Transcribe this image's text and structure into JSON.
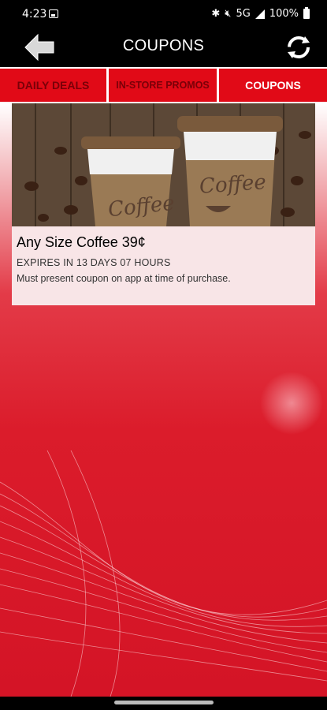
{
  "status_bar": {
    "time": "4:23",
    "network": "5G",
    "battery": "100%",
    "icons": [
      "image-icon",
      "bluetooth-icon",
      "mute-icon",
      "signal-icon",
      "battery-icon"
    ]
  },
  "header": {
    "title": "COUPONS",
    "back_icon": "back-arrow-icon",
    "refresh_icon": "refresh-icon"
  },
  "tabs": [
    {
      "label": "DAILY DEALS",
      "active": false
    },
    {
      "label": "IN-STORE PROMOS",
      "active": false
    },
    {
      "label": "COUPONS",
      "active": true
    }
  ],
  "coupon": {
    "image_text_left": "Coffee",
    "image_text_right": "Coffee",
    "title": "Any Size Coffee 39¢",
    "expiry": "EXPIRES IN 13 DAYS 07 HOURS",
    "note": "Must present coupon on app at time of purchase."
  },
  "colors": {
    "brand_red": "#e10a17",
    "inactive_tab_text": "#7a0008",
    "card_bg": "#f8e5e7"
  }
}
